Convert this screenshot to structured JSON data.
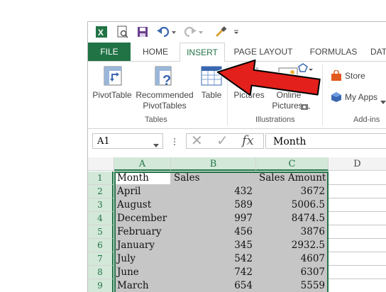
{
  "tabs": {
    "file": "FILE",
    "home": "HOME",
    "insert": "INSERT",
    "page_layout": "PAGE LAYOUT",
    "formulas": "FORMULAS",
    "data": "DAT"
  },
  "ribbon": {
    "pivottable": "PivotTable",
    "recommended_line1": "Recommended",
    "recommended_line2": "PivotTables",
    "table": "Table",
    "pictures": "Pictures",
    "online_pictures_line1": "Online",
    "online_pictures_line2": "Pictures",
    "store": "Store",
    "my_apps": "My Apps",
    "group_tables": "Tables",
    "group_illustrations": "Illustrations",
    "group_addins": "Add-ins"
  },
  "formula_bar": {
    "name_box": "A1",
    "cancel_symbol": "✕",
    "enter_symbol": "✓",
    "fx_symbol": "fx",
    "content": "Month"
  },
  "sheet": {
    "columns": [
      "A",
      "B",
      "C",
      "D"
    ],
    "rows": [
      "1",
      "2",
      "3",
      "4",
      "5",
      "6",
      "7",
      "8",
      "9"
    ],
    "data": [
      [
        "Month",
        "Sales",
        "Sales Amount"
      ],
      [
        "April",
        "432",
        "3672"
      ],
      [
        "August",
        "589",
        "5006.5"
      ],
      [
        "December",
        "997",
        "8474.5"
      ],
      [
        "February",
        "456",
        "3876"
      ],
      [
        "January",
        "345",
        "2932.5"
      ],
      [
        "July",
        "542",
        "4607"
      ],
      [
        "June",
        "742",
        "6307"
      ],
      [
        "March",
        "654",
        "5559"
      ]
    ]
  },
  "colors": {
    "excel_green": "#217346",
    "arrow_red": "#e3201b",
    "selection_gray": "#c6c6c6"
  }
}
